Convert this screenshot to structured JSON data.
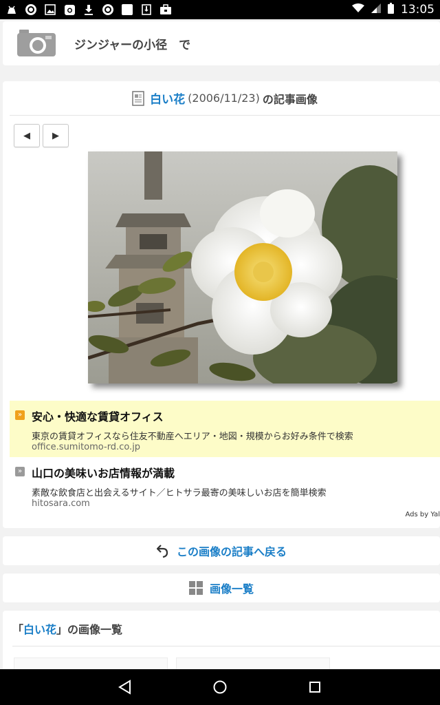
{
  "status_bar": {
    "time": "13:05",
    "left_icons": [
      "android-debug-icon",
      "sync-circle-icon",
      "image-icon",
      "instagram-icon",
      "download-icon",
      "sync-circle-icon",
      "blank-square-icon",
      "download-box-icon",
      "briefcase-icon"
    ],
    "right_icons": [
      "wifi-icon",
      "signal-icon",
      "battery-icon"
    ]
  },
  "header": {
    "title": "ジンジャーの小径　で"
  },
  "article": {
    "title_link": "白い花",
    "title_date": "(2006/11/23)",
    "title_suffix": "の記事画像",
    "prev_label": "◀",
    "next_label": "▶"
  },
  "ads": {
    "items": [
      {
        "marker": "»",
        "title": "安心・快適な賃貸オフィス",
        "description": "東京の賃貸オフィスなら住友不動産へエリア・地図・規模からお好み条件で検索",
        "url": "office.sumitomo-rd.co.jp"
      },
      {
        "marker": "»",
        "title": "山口の美味いお店情報が満載",
        "description": "素敵な飲食店と出会えるサイト／ヒトサラ最寄の美味しいお店を簡単検索",
        "url": "hitosara.com"
      }
    ],
    "ads_by": "Ads by Yal"
  },
  "buttons": {
    "back_label": "この画像の記事へ戻る",
    "list_label": "画像一覧"
  },
  "image_list": {
    "open_quote": "「",
    "link": "白い花",
    "suffix": "」の画像一覧"
  },
  "colors": {
    "link": "#1a7ec7",
    "ad_highlight": "#fdfcc8",
    "ad_marker": "#f0a11c"
  }
}
